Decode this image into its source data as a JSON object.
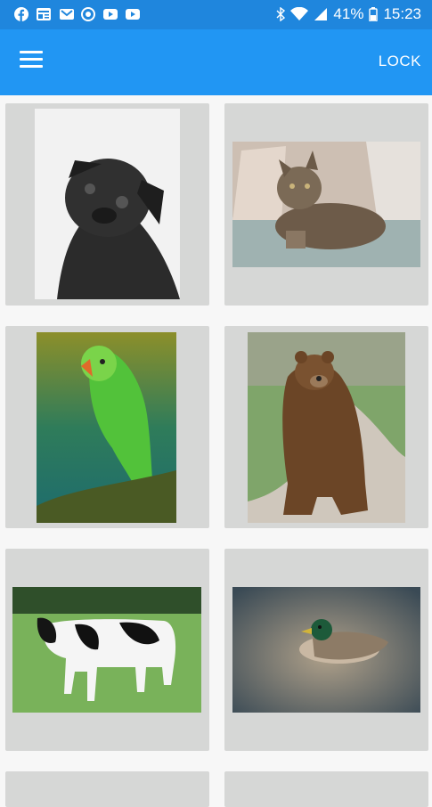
{
  "status_bar": {
    "battery": "41%",
    "time": "15:23",
    "icons": [
      "facebook-icon",
      "news-icon",
      "mail-icon",
      "vpn-icon",
      "youtube-icon",
      "youtube-icon",
      "bluetooth-icon",
      "wifi-icon",
      "signal-icon",
      "battery-icon"
    ]
  },
  "app_bar": {
    "menu_icon": "hamburger-menu-icon",
    "action_label": "LOCK"
  },
  "gallery": {
    "items": [
      {
        "subject": "pug"
      },
      {
        "subject": "tabby-cat"
      },
      {
        "subject": "green-parrot"
      },
      {
        "subject": "brown-bear"
      },
      {
        "subject": "holstein-cow"
      },
      {
        "subject": "mallard-duck"
      }
    ]
  },
  "colors": {
    "status_bar": "#1f86dd",
    "app_bar": "#2196f3",
    "card_bg": "#d6d7d6",
    "page_bg": "#f7f7f7"
  }
}
